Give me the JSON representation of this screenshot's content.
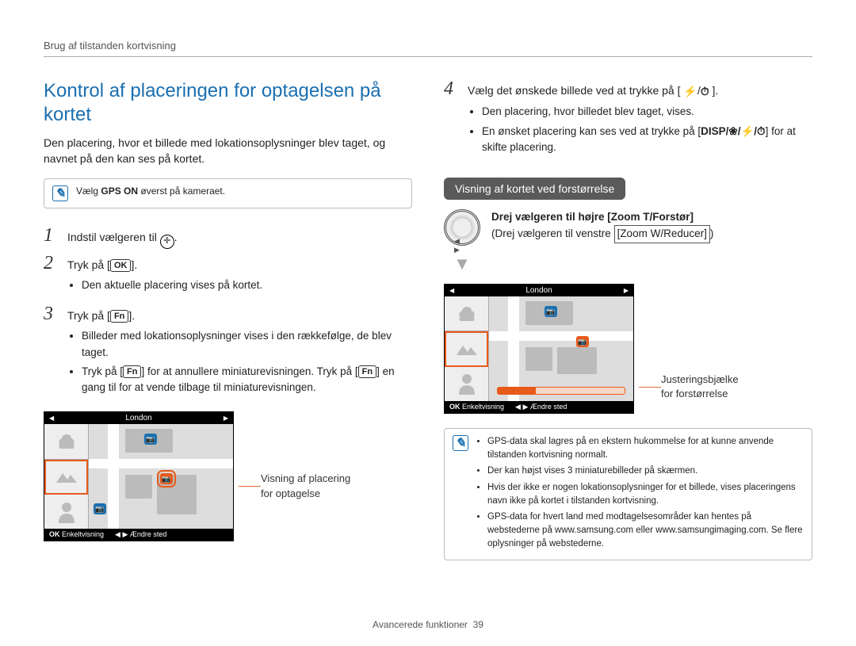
{
  "header": "Brug af tilstanden kortvisning",
  "title": "Kontrol af placeringen for optagelsen på kortet",
  "intro": "Den placering, hvor et billede med lokationsoplysninger blev taget, og navnet på den kan ses på kortet.",
  "note1_prefix": "Vælg ",
  "note1_bold": "GPS ON",
  "note1_suffix": " øverst på kameraet.",
  "step1": "Indstil vælgeren til ",
  "step2": "Tryk på [",
  "step2_key": "OK",
  "step2_suffix": "].",
  "step2_b1": "Den aktuelle placering vises på kortet.",
  "step3": "Tryk på [",
  "step3_key": "Fn",
  "step3_suffix": "].",
  "step3_b1": "Billeder med lokationsoplysninger vises i den rækkefølge, de blev taget.",
  "step3_b2_a": "Tryk på [",
  "step3_b2_key1": "Fn",
  "step3_b2_b": "] for at annullere miniaturevisningen. Tryk på [",
  "step3_b2_key2": "Fn",
  "step3_b2_c": "] en gang til for at vende tilbage til miniaturevisningen.",
  "screen_city": "London",
  "screen_ok": "OK",
  "screen_single": "Enkeltvisning",
  "screen_arrows": "◀ ▶",
  "screen_change": "Ændre sted",
  "callout_left_1": "Visning af placering",
  "callout_left_2": "for optagelse",
  "step4_a": "Vælg det ønskede billede ved at trykke på [",
  "step4_b": "].",
  "step4_b1": "Den placering, hvor billedet blev taget, vises.",
  "step4_b2_a": "En ønsket placering kan ses ved at trykke på [",
  "step4_b2_keys": "DISP/❀/⚡/⏱",
  "step4_b2_b": "] for at skifte placering.",
  "section_pill": "Visning af kortet ved forstørrelse",
  "dial_bold": "Drej vælgeren til højre [Zoom T/Forstør]",
  "dial_line2_a": "Drej vælgeren til venstre ",
  "dial_line2_box": "[Zoom W/Reducer]",
  "dial_line2_b": ")",
  "callout_right_1": "Justeringsbjælke",
  "callout_right_2": "for forstørrelse",
  "note2_1": "GPS-data skal lagres på en ekstern hukommelse for at kunne anvende tilstanden kortvisning normalt.",
  "note2_2": "Der kan højst vises 3 miniaturebilleder på skærmen.",
  "note2_3": "Hvis der ikke er nogen lokationsoplysninger for et billede, vises placeringens navn ikke på kortet i tilstanden kortvisning.",
  "note2_4": "GPS-data for hvert land med modtagelsesområder kan hentes på webstederne på www.samsung.com eller www.samsungimaging.com. Se flere oplysninger på webstederne.",
  "footer_label": "Avancerede funktioner",
  "footer_page": "39",
  "icons": {
    "flash": "⚡",
    "timer": "⏱",
    "camera": "📷"
  }
}
